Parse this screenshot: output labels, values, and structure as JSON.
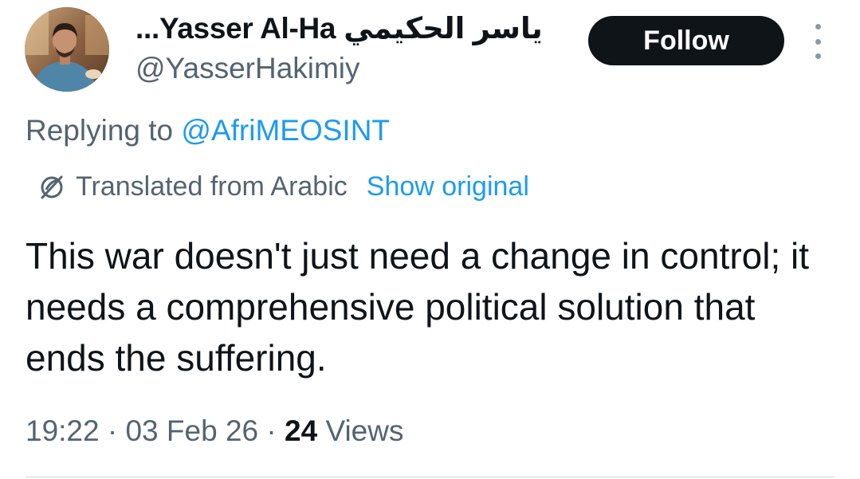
{
  "author": {
    "display_name": "...Yasser Al-Ha ياسر الحكيمي",
    "handle": "@YasserHakimiy"
  },
  "actions": {
    "follow_label": "Follow",
    "more_icon": "more-vertical-icon"
  },
  "reply": {
    "prefix": "Replying to ",
    "mention": "@AfriMEOSINT"
  },
  "translation": {
    "icon": "translate-globe-icon",
    "label": "Translated from Arabic",
    "show_original": "Show original"
  },
  "tweet": {
    "text": "This war doesn't just need a change in control; it needs a comprehensive political solution that ends the suffering."
  },
  "meta": {
    "time": "19:22",
    "separator": " · ",
    "date": "03 Feb 26",
    "views_count": "24",
    "views_label": " Views"
  },
  "colors": {
    "text": "#0f1419",
    "secondary": "#536471",
    "accent": "#1d9bf0",
    "follow_bg": "#0f1419",
    "divider": "#cfd9de"
  }
}
